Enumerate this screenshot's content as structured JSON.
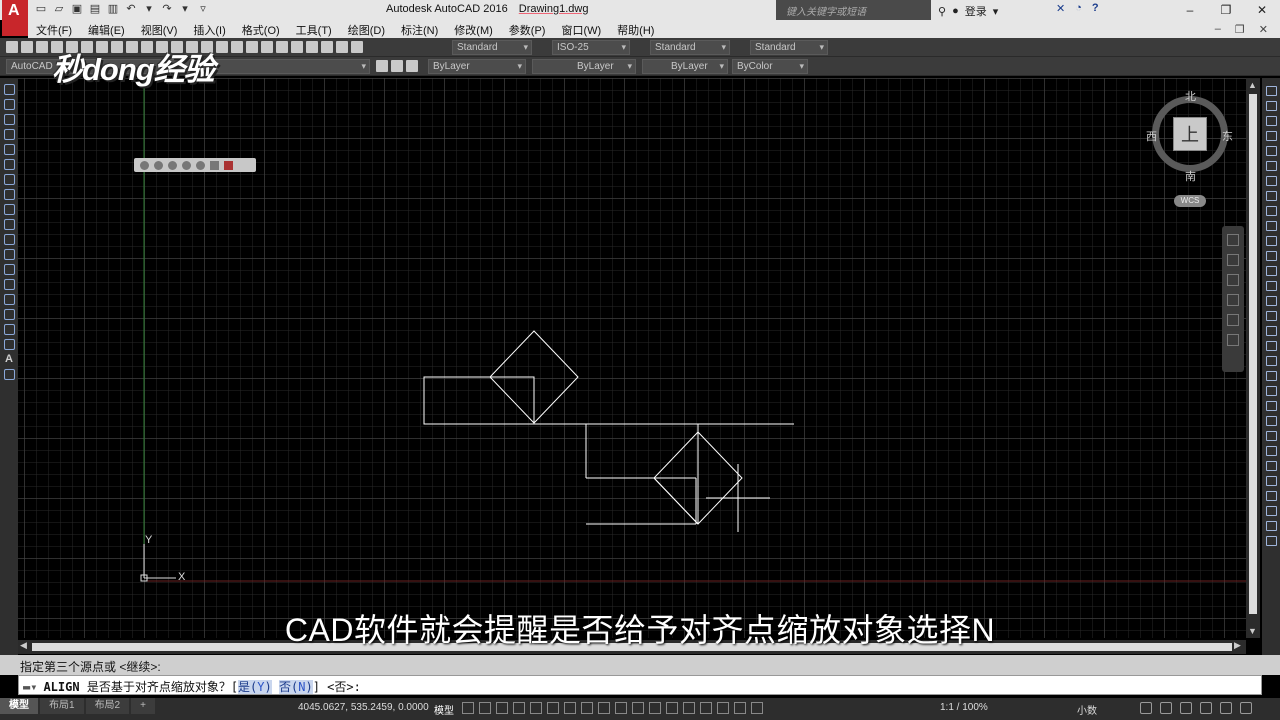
{
  "window": {
    "app_title": "Autodesk AutoCAD 2016",
    "document": "Drawing1.dwg",
    "search_placeholder": "键入关键字或短语",
    "signin_label": "登录",
    "app_logo": "A"
  },
  "menu": {
    "items": [
      "文件(F)",
      "编辑(E)",
      "视图(V)",
      "插入(I)",
      "格式(O)",
      "工具(T)",
      "绘图(D)",
      "标注(N)",
      "修改(M)",
      "参数(P)",
      "窗口(W)",
      "帮助(H)"
    ]
  },
  "toolbar1": {
    "text_style": "Standard",
    "dim_style": "ISO-25",
    "table_style": "Standard",
    "mleader_style": "Standard"
  },
  "toolbar2": {
    "workspace": "AutoCAD",
    "color": "ByLayer",
    "linetype": "ByLayer",
    "lineweight": "ByLayer",
    "plot_style": "ByColor"
  },
  "watermark": "秒dong经验",
  "viewcube": {
    "north": "北",
    "south": "南",
    "east": "东",
    "west": "西",
    "top_face": "上",
    "wcs": "WCS"
  },
  "ucs": {
    "x_label": "X",
    "y_label": "Y"
  },
  "subtitle": "CAD软件就会提醒是否给予对齐点缩放对象选择N",
  "command": {
    "history": "指定第三个源点或 <继续>:",
    "name": "ALIGN",
    "prompt": "是否基于对齐点缩放对象？[",
    "opt_yes_text": "是(",
    "opt_yes_key": "Y",
    "opt_no_text": "否(",
    "opt_no_key": "N",
    "suffix": "] <否>:"
  },
  "status": {
    "tabs": [
      "模型",
      "布局1",
      "布局2"
    ],
    "add_tab": "+",
    "coords": "4045.0627, 535.2459, 0.0000",
    "mode": "模型",
    "scale": "1:1 / 100%",
    "units": "小数"
  }
}
